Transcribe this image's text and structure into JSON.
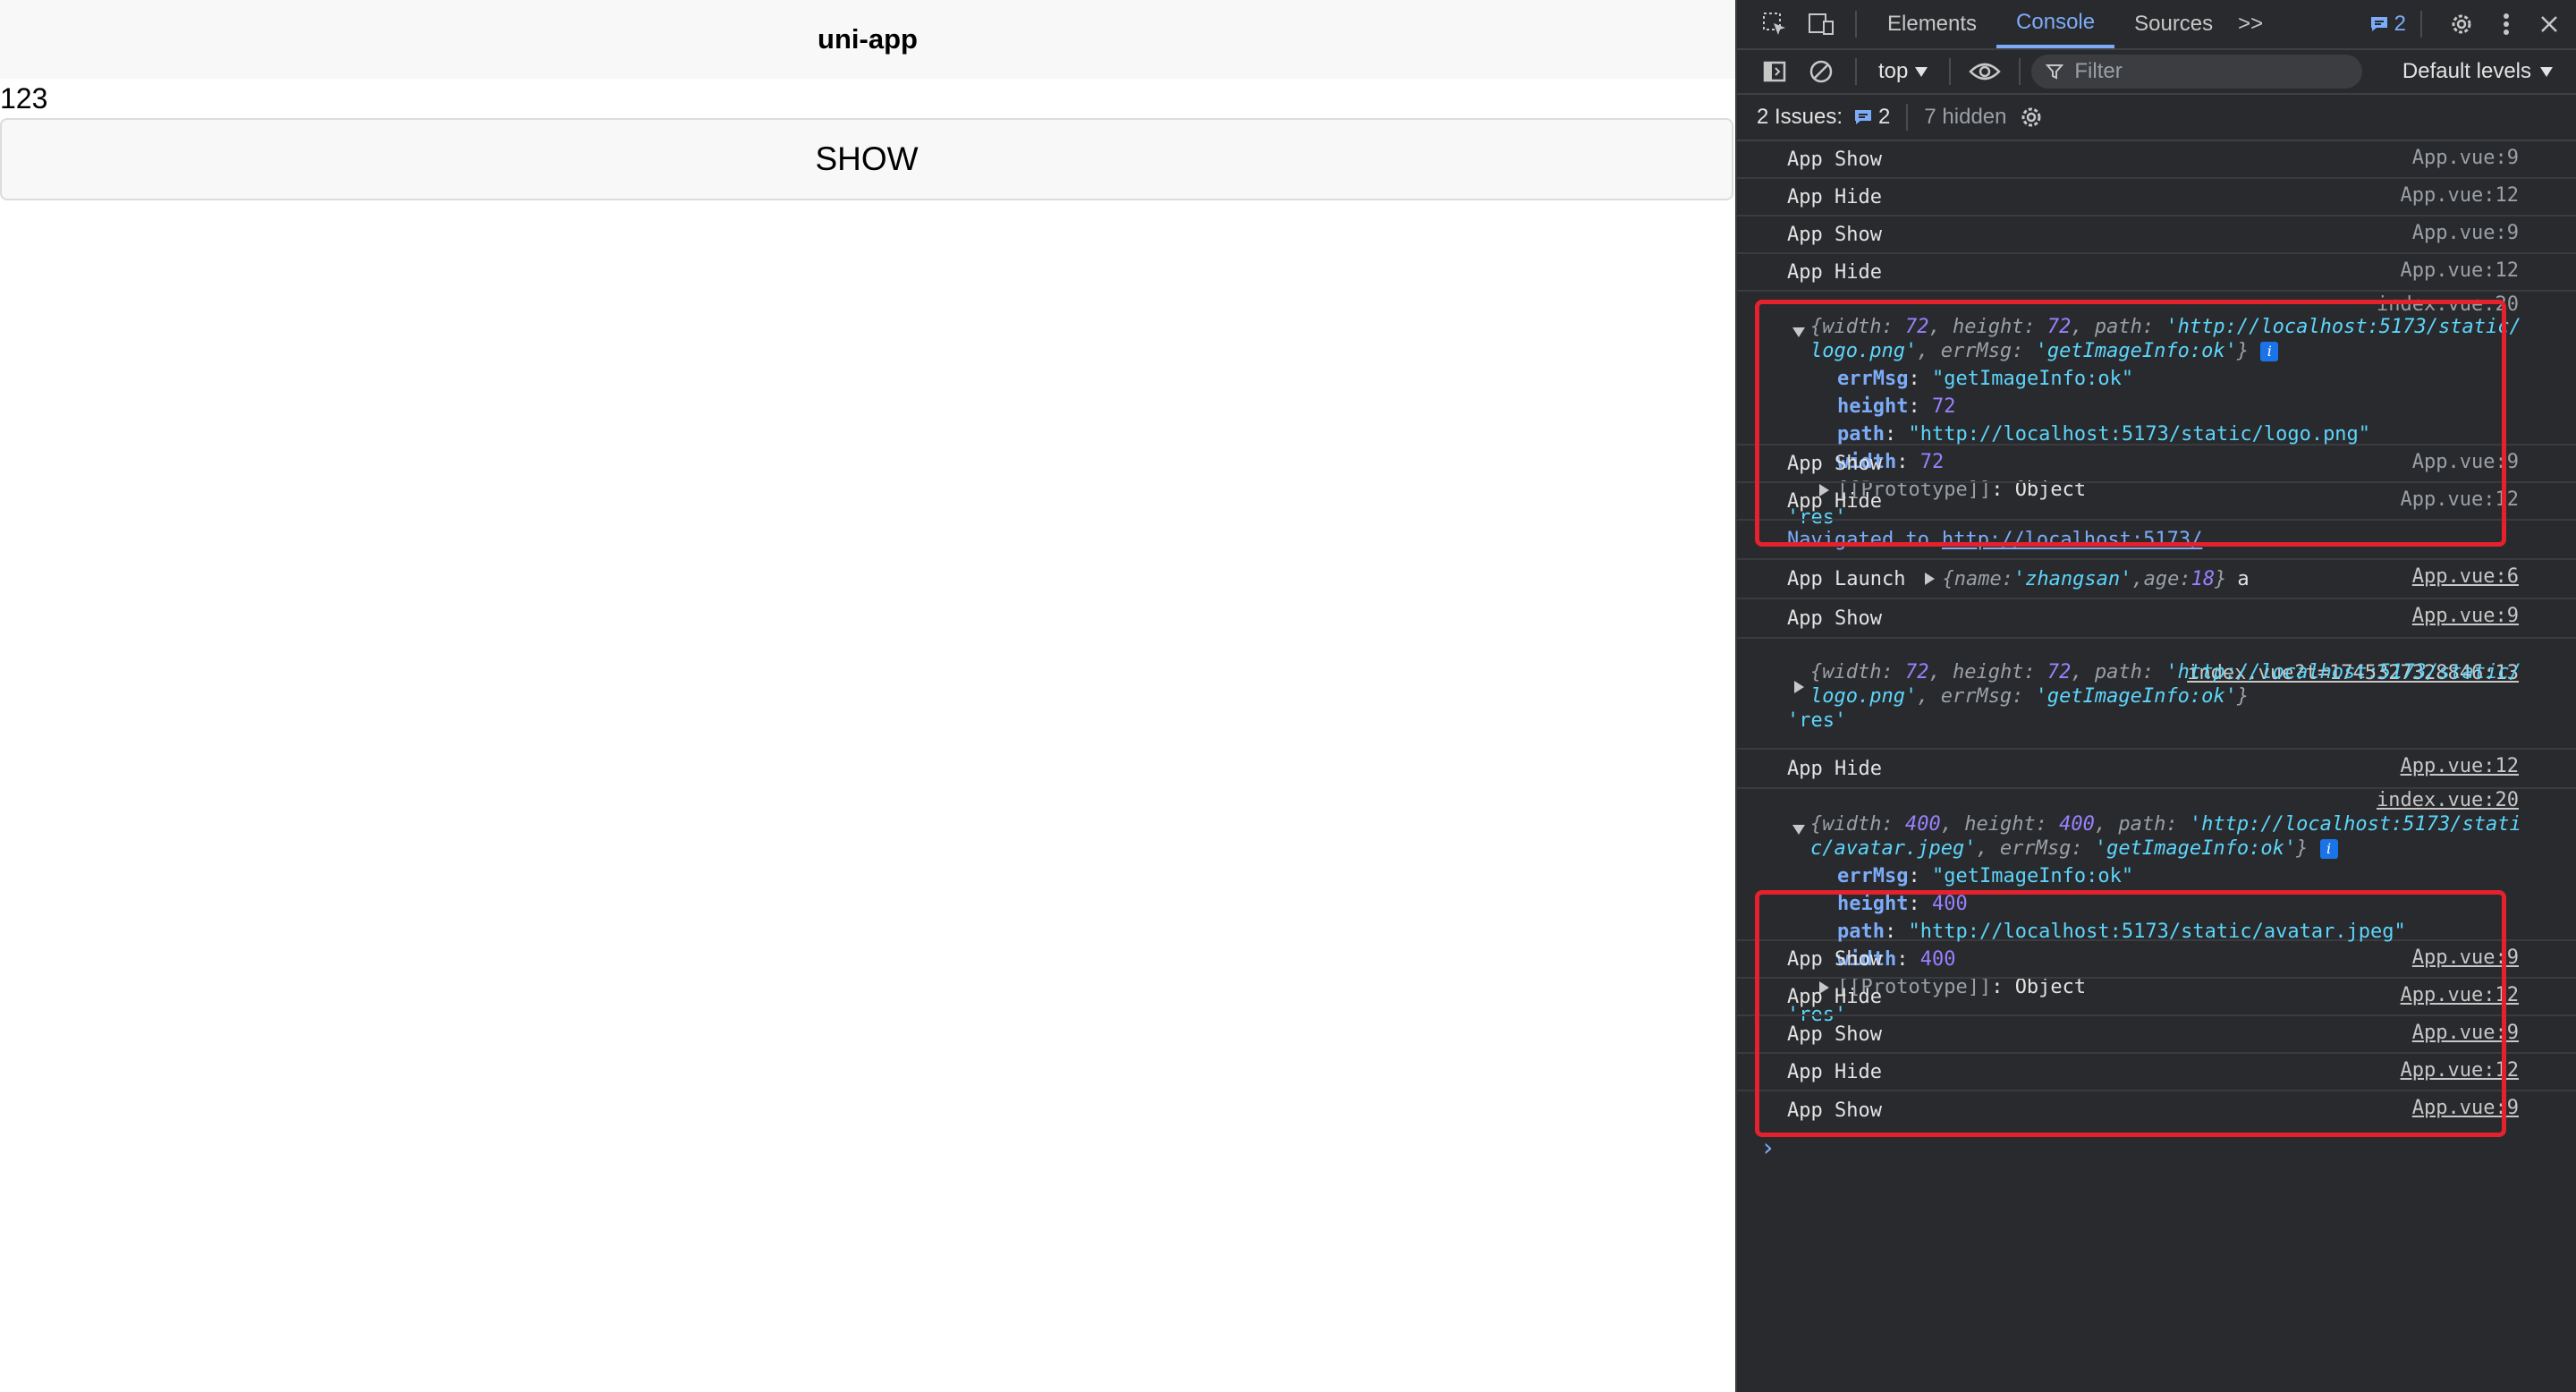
{
  "app": {
    "nav_title": "uni-app",
    "counter": "123",
    "show_button": "SHOW"
  },
  "devtools": {
    "tabs": [
      "Elements",
      "Console",
      "Sources"
    ],
    "more_tabs": ">>",
    "issues_badge": "2",
    "context": "top",
    "filter_placeholder": "Filter",
    "levels": "Default levels",
    "issues_label": "2 Issues:",
    "issues_count": "2",
    "issues_hidden": "7 hidden",
    "colors": {
      "accent": "#7cacf8",
      "highlight_box": "#e5212d",
      "background": "#292a2d"
    }
  },
  "console": {
    "rows1": [
      {
        "text": "App Show",
        "src": "App.vue:9"
      },
      {
        "text": "App Hide",
        "src": "App.vue:12"
      },
      {
        "text": "App Show",
        "src": "App.vue:9"
      },
      {
        "text": "App Hide",
        "src": "App.vue:12"
      }
    ],
    "obj1": {
      "src": "index.vue:20",
      "summary_line1_prefix": "{width: ",
      "summary_width": "72",
      "summary_height_key": ", height: ",
      "summary_height": "72",
      "summary_path_key": ", path: ",
      "summary_path1": "'http://localhost:5173/static/",
      "summary_path2": "logo.png'",
      "summary_errmsg_key": ", errMsg: ",
      "summary_errmsg": "'getImageInfo:ok'",
      "summary_close": "}",
      "errMsg_key": "errMsg",
      "errMsg_val": "\"getImageInfo:ok\"",
      "height_key": "height",
      "height_val": "72",
      "path_key": "path",
      "path_val": "\"http://localhost:5173/static/logo.png\"",
      "width_key": "width",
      "width_val": "72",
      "proto": "[[Prototype]]",
      "proto_val": "Object",
      "tail": "'res'"
    },
    "rows2": [
      {
        "text": "App Show",
        "src": "App.vue:9"
      },
      {
        "text": "App Hide",
        "src": "App.vue:12"
      }
    ],
    "navigated_prefix": "Navigated to",
    "navigated_url": "http://localhost:5173/",
    "launch": {
      "text": "App Launch",
      "obj_open": "{",
      "name_key": "name",
      "name_val": "'zhangsan'",
      "age_key": "age",
      "age_val": "18",
      "obj_close": "}",
      "suffix": "a",
      "src": "App.vue:6"
    },
    "show_after_launch": {
      "text": "App Show",
      "src": "App.vue:9"
    },
    "obj_collapsed": {
      "src": "index.vue?t=1745327328846:13",
      "width": "72",
      "height": "72",
      "path1": "'http://localhost:5173/static/",
      "path2": "logo.png'",
      "errmsg": "'getImageInfo:ok'",
      "tail": "'res'"
    },
    "hide_after": {
      "text": "App Hide",
      "src": "App.vue:12"
    },
    "obj2": {
      "src": "index.vue:20",
      "summary_width": "400",
      "summary_height": "400",
      "summary_path1": "'http://localhost:5173/stati",
      "summary_path2": "c/avatar.jpeg'",
      "summary_errmsg": "'getImageInfo:ok'",
      "errMsg_key": "errMsg",
      "errMsg_val": "\"getImageInfo:ok\"",
      "height_key": "height",
      "height_val": "400",
      "path_key": "path",
      "path_val": "\"http://localhost:5173/static/avatar.jpeg\"",
      "width_key": "width",
      "width_val": "400",
      "proto": "[[Prototype]]",
      "proto_val": "Object",
      "tail": "'res'"
    },
    "rows3": [
      {
        "text": "App Show",
        "src": "App.vue:9"
      },
      {
        "text": "App Hide",
        "src": "App.vue:12"
      },
      {
        "text": "App Show",
        "src": "App.vue:9"
      },
      {
        "text": "App Hide",
        "src": "App.vue:12"
      },
      {
        "text": "App Show",
        "src": "App.vue:9"
      }
    ],
    "prompt": "›"
  }
}
